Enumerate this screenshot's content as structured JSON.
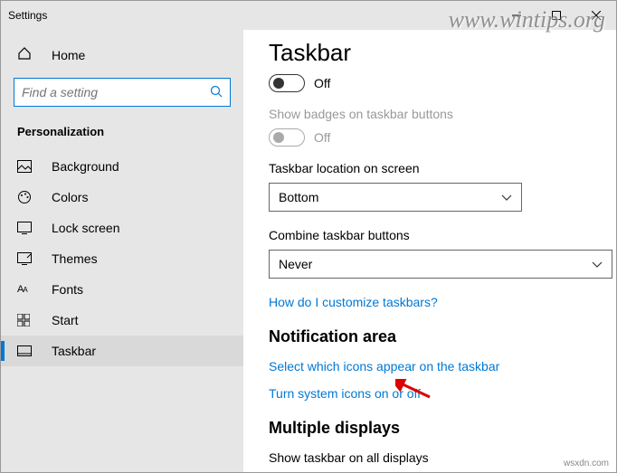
{
  "window": {
    "title": "Settings"
  },
  "sidebar": {
    "home": "Home",
    "search_placeholder": "Find a setting",
    "category": "Personalization",
    "items": [
      {
        "label": "Background"
      },
      {
        "label": "Colors"
      },
      {
        "label": "Lock screen"
      },
      {
        "label": "Themes"
      },
      {
        "label": "Fonts"
      },
      {
        "label": "Start"
      },
      {
        "label": "Taskbar"
      }
    ]
  },
  "content": {
    "title": "Taskbar",
    "toggle1_label": "Off",
    "badges_heading": "Show badges on taskbar buttons",
    "badges_label": "Off",
    "location_heading": "Taskbar location on screen",
    "location_value": "Bottom",
    "combine_heading": "Combine taskbar buttons",
    "combine_value": "Never",
    "customize_link": "How do I customize taskbars?",
    "notif_title": "Notification area",
    "notif_link1": "Select which icons appear on the taskbar",
    "notif_link2": "Turn system icons on or off",
    "multi_title": "Multiple displays",
    "multi_heading": "Show taskbar on all displays"
  },
  "watermark": "www.wintips.org",
  "credit": "wsxdn.com"
}
